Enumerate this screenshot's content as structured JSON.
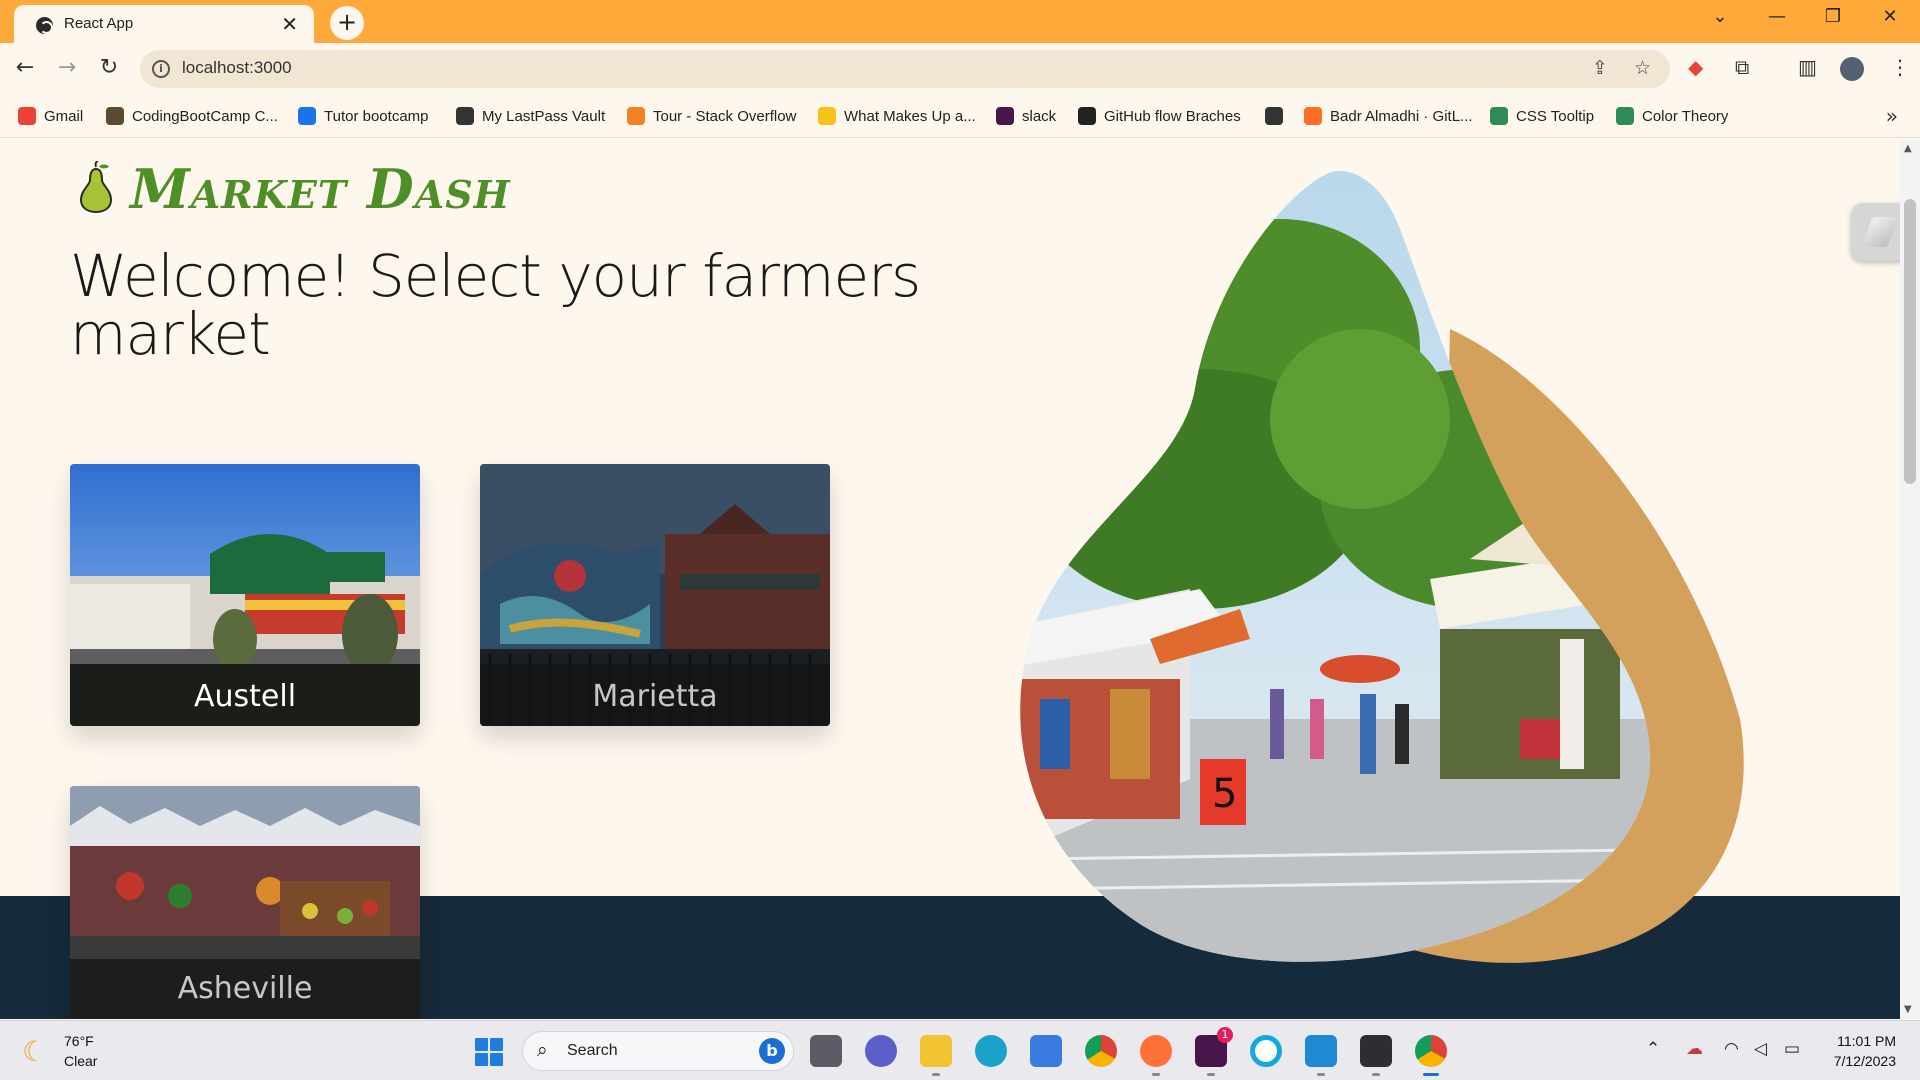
{
  "browser": {
    "tab_title": "React App",
    "url": "localhost:3000",
    "bookmarks": [
      {
        "label": "Gmail",
        "color": "#ea4335"
      },
      {
        "label": "CodingBootCamp C...",
        "color": "#5b4a2e"
      },
      {
        "label": "Tutor bootcamp",
        "color": "#1a73e8"
      },
      {
        "label": "My LastPass Vault",
        "color": "#333333"
      },
      {
        "label": "Tour - Stack Overflow",
        "color": "#f48024"
      },
      {
        "label": "What Makes Up a...",
        "color": "#f7c21b"
      },
      {
        "label": "slack",
        "color": "#4a154b"
      },
      {
        "label": "GitHub flow Braches",
        "color": "#222222"
      },
      {
        "label": "",
        "color": "#333333"
      },
      {
        "label": "Badr Almadhi · GitL...",
        "color": "#fc6d26"
      },
      {
        "label": "CSS Tooltip",
        "color": "#2e8b57"
      },
      {
        "label": "Color Theory",
        "color": "#2e8b57"
      }
    ]
  },
  "page": {
    "brand": "Market Dash",
    "heading": "Welcome! Select your farmers market",
    "markets": [
      {
        "name": "Austell"
      },
      {
        "name": "Marietta"
      },
      {
        "name": "Asheville"
      }
    ]
  },
  "taskbar": {
    "temperature": "76°F",
    "condition": "Clear",
    "search_label": "Search",
    "time": "11:01 PM",
    "date": "7/12/2023",
    "slack_badge": "1"
  },
  "colors": {
    "tab_strip": "#ffa93a",
    "page_bg": "#fdf7ee",
    "brand_green": "#4f8f27",
    "footer_navy": "#152a3a",
    "blob_tan": "#d4a15c"
  }
}
